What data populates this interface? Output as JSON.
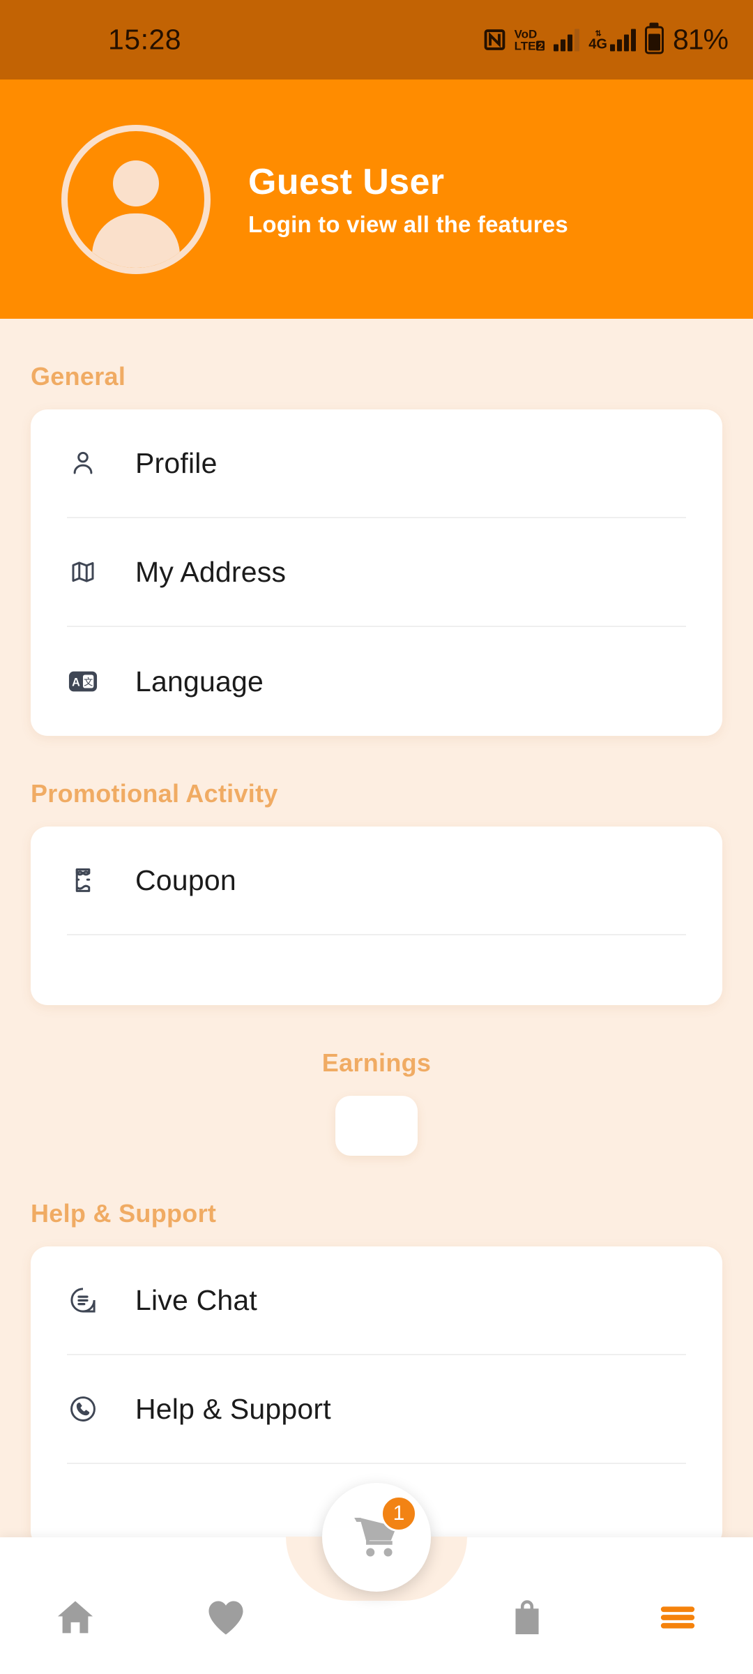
{
  "status_bar": {
    "time": "15:28",
    "battery_percent": "81%",
    "nfc_icon": "nfc-icon",
    "volte_line1": "VoD",
    "volte_line2": "LTE",
    "volte_sim": "2",
    "network_type": "4G",
    "signal_icon": "signal-bars-icon",
    "battery_icon": "battery-icon",
    "bg_color": "#C26304"
  },
  "header": {
    "name": "Guest User",
    "subtitle": "Login to view all the features",
    "avatar_icon": "user-avatar-icon",
    "bg_color": "#FF8C00"
  },
  "theme": {
    "page_bg": "#FDEEE1",
    "accent": "#FF8C00",
    "section_title_color": "#F0AB63",
    "card_bg": "#FFFFFF",
    "icon_color": "#3F4654"
  },
  "sections": [
    {
      "title": "General",
      "align": "left",
      "items": [
        {
          "label": "Profile",
          "icon": "person-icon"
        },
        {
          "label": "My Address",
          "icon": "map-icon"
        },
        {
          "label": "Language",
          "icon": "translate-icon"
        }
      ]
    },
    {
      "title": "Promotional Activity",
      "align": "left",
      "items": [
        {
          "label": "Coupon",
          "icon": "coupon-ticket-icon"
        }
      ]
    },
    {
      "title": "Earnings",
      "align": "center",
      "items": []
    },
    {
      "title": "Help & Support",
      "align": "left",
      "items": [
        {
          "label": "Live Chat",
          "icon": "chat-bubble-icon"
        },
        {
          "label": "Help & Support",
          "icon": "phone-circle-icon"
        }
      ]
    }
  ],
  "bottom_nav": {
    "items": [
      {
        "name": "home",
        "icon": "home-icon",
        "active": false
      },
      {
        "name": "wishlist",
        "icon": "heart-icon",
        "active": false
      },
      {
        "name": "orders",
        "icon": "shopping-bag-icon",
        "active": false
      },
      {
        "name": "menu",
        "icon": "hamburger-menu-icon",
        "active": true
      }
    ],
    "cart": {
      "icon": "shopping-cart-icon",
      "badge_count": "1",
      "badge_color": "#F28314"
    },
    "active_color": "#F5820B",
    "inactive_color": "#9E9E9E"
  }
}
